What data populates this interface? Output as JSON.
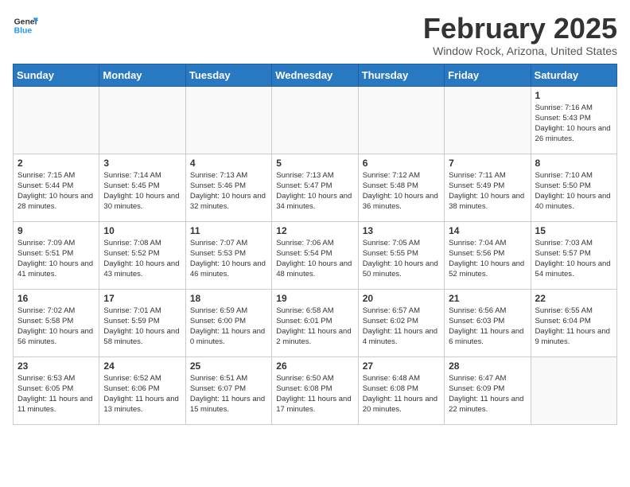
{
  "header": {
    "logo": {
      "general": "General",
      "blue": "Blue"
    },
    "title": "February 2025",
    "location": "Window Rock, Arizona, United States"
  },
  "weekdays": [
    "Sunday",
    "Monday",
    "Tuesday",
    "Wednesday",
    "Thursday",
    "Friday",
    "Saturday"
  ],
  "weeks": [
    [
      {
        "day": "",
        "info": ""
      },
      {
        "day": "",
        "info": ""
      },
      {
        "day": "",
        "info": ""
      },
      {
        "day": "",
        "info": ""
      },
      {
        "day": "",
        "info": ""
      },
      {
        "day": "",
        "info": ""
      },
      {
        "day": "1",
        "info": "Sunrise: 7:16 AM\nSunset: 5:43 PM\nDaylight: 10 hours and 26 minutes."
      }
    ],
    [
      {
        "day": "2",
        "info": "Sunrise: 7:15 AM\nSunset: 5:44 PM\nDaylight: 10 hours and 28 minutes."
      },
      {
        "day": "3",
        "info": "Sunrise: 7:14 AM\nSunset: 5:45 PM\nDaylight: 10 hours and 30 minutes."
      },
      {
        "day": "4",
        "info": "Sunrise: 7:13 AM\nSunset: 5:46 PM\nDaylight: 10 hours and 32 minutes."
      },
      {
        "day": "5",
        "info": "Sunrise: 7:13 AM\nSunset: 5:47 PM\nDaylight: 10 hours and 34 minutes."
      },
      {
        "day": "6",
        "info": "Sunrise: 7:12 AM\nSunset: 5:48 PM\nDaylight: 10 hours and 36 minutes."
      },
      {
        "day": "7",
        "info": "Sunrise: 7:11 AM\nSunset: 5:49 PM\nDaylight: 10 hours and 38 minutes."
      },
      {
        "day": "8",
        "info": "Sunrise: 7:10 AM\nSunset: 5:50 PM\nDaylight: 10 hours and 40 minutes."
      }
    ],
    [
      {
        "day": "9",
        "info": "Sunrise: 7:09 AM\nSunset: 5:51 PM\nDaylight: 10 hours and 41 minutes."
      },
      {
        "day": "10",
        "info": "Sunrise: 7:08 AM\nSunset: 5:52 PM\nDaylight: 10 hours and 43 minutes."
      },
      {
        "day": "11",
        "info": "Sunrise: 7:07 AM\nSunset: 5:53 PM\nDaylight: 10 hours and 46 minutes."
      },
      {
        "day": "12",
        "info": "Sunrise: 7:06 AM\nSunset: 5:54 PM\nDaylight: 10 hours and 48 minutes."
      },
      {
        "day": "13",
        "info": "Sunrise: 7:05 AM\nSunset: 5:55 PM\nDaylight: 10 hours and 50 minutes."
      },
      {
        "day": "14",
        "info": "Sunrise: 7:04 AM\nSunset: 5:56 PM\nDaylight: 10 hours and 52 minutes."
      },
      {
        "day": "15",
        "info": "Sunrise: 7:03 AM\nSunset: 5:57 PM\nDaylight: 10 hours and 54 minutes."
      }
    ],
    [
      {
        "day": "16",
        "info": "Sunrise: 7:02 AM\nSunset: 5:58 PM\nDaylight: 10 hours and 56 minutes."
      },
      {
        "day": "17",
        "info": "Sunrise: 7:01 AM\nSunset: 5:59 PM\nDaylight: 10 hours and 58 minutes."
      },
      {
        "day": "18",
        "info": "Sunrise: 6:59 AM\nSunset: 6:00 PM\nDaylight: 11 hours and 0 minutes."
      },
      {
        "day": "19",
        "info": "Sunrise: 6:58 AM\nSunset: 6:01 PM\nDaylight: 11 hours and 2 minutes."
      },
      {
        "day": "20",
        "info": "Sunrise: 6:57 AM\nSunset: 6:02 PM\nDaylight: 11 hours and 4 minutes."
      },
      {
        "day": "21",
        "info": "Sunrise: 6:56 AM\nSunset: 6:03 PM\nDaylight: 11 hours and 6 minutes."
      },
      {
        "day": "22",
        "info": "Sunrise: 6:55 AM\nSunset: 6:04 PM\nDaylight: 11 hours and 9 minutes."
      }
    ],
    [
      {
        "day": "23",
        "info": "Sunrise: 6:53 AM\nSunset: 6:05 PM\nDaylight: 11 hours and 11 minutes."
      },
      {
        "day": "24",
        "info": "Sunrise: 6:52 AM\nSunset: 6:06 PM\nDaylight: 11 hours and 13 minutes."
      },
      {
        "day": "25",
        "info": "Sunrise: 6:51 AM\nSunset: 6:07 PM\nDaylight: 11 hours and 15 minutes."
      },
      {
        "day": "26",
        "info": "Sunrise: 6:50 AM\nSunset: 6:08 PM\nDaylight: 11 hours and 17 minutes."
      },
      {
        "day": "27",
        "info": "Sunrise: 6:48 AM\nSunset: 6:08 PM\nDaylight: 11 hours and 20 minutes."
      },
      {
        "day": "28",
        "info": "Sunrise: 6:47 AM\nSunset: 6:09 PM\nDaylight: 11 hours and 22 minutes."
      },
      {
        "day": "",
        "info": ""
      }
    ]
  ]
}
